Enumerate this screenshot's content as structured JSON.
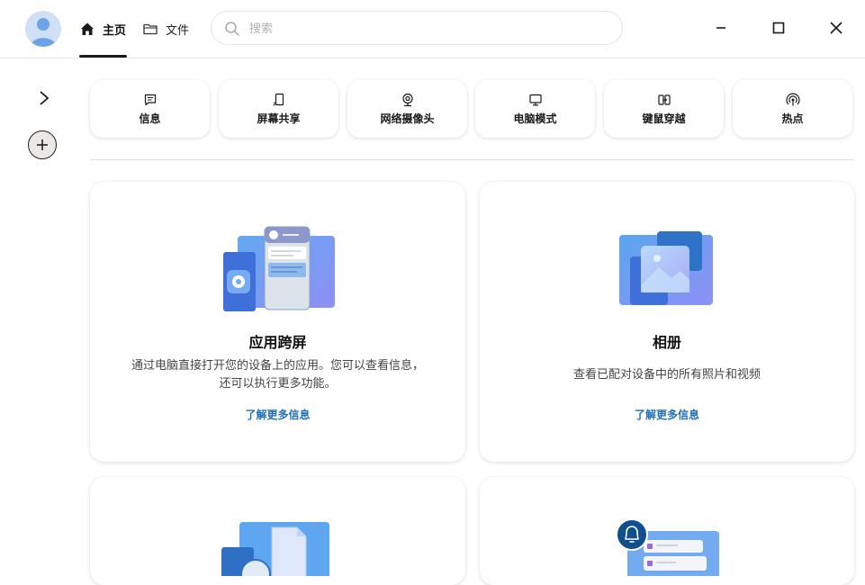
{
  "header": {
    "tabs": [
      {
        "label": "主页",
        "icon": "home-icon",
        "active": true
      },
      {
        "label": "文件",
        "icon": "folder-icon",
        "active": false
      }
    ],
    "search": {
      "placeholder": "搜索",
      "value": ""
    },
    "window_controls": [
      "minimize-icon",
      "maximize-icon",
      "close-icon"
    ]
  },
  "sidebar": {
    "toggle_icon": "chevron-right-icon",
    "add_icon": "plus-icon"
  },
  "quick_actions": [
    {
      "label": "信息",
      "icon": "message-icon"
    },
    {
      "label": "屏幕共享",
      "icon": "screen-cast-icon"
    },
    {
      "label": "网络摄像头",
      "icon": "webcam-icon"
    },
    {
      "label": "电脑模式",
      "icon": "monitor-icon"
    },
    {
      "label": "键鼠穿越",
      "icon": "keyboard-mouse-icon"
    },
    {
      "label": "热点",
      "icon": "hotspot-icon"
    }
  ],
  "cards": [
    {
      "title": "应用跨屏",
      "description": "通过电脑直接打开您的设备上的应用。您可以查看信息，还可以执行更多功能。",
      "link": "了解更多信息",
      "illustration": "phone-apps-illustration"
    },
    {
      "title": "相册",
      "description": "查看已配对设备中的所有照片和视频",
      "link": "了解更多信息",
      "illustration": "photo-gallery-illustration"
    },
    {
      "title": "",
      "description": "",
      "link": "",
      "illustration": "files-illustration"
    },
    {
      "title": "",
      "description": "",
      "link": "",
      "illustration": "notifications-illustration"
    }
  ],
  "colors": {
    "accent": "#1f6fb8",
    "illustration_blue": "#6aa8ee",
    "illustration_purple": "#8f8ff5",
    "dark_blue": "#0f4f8c"
  }
}
